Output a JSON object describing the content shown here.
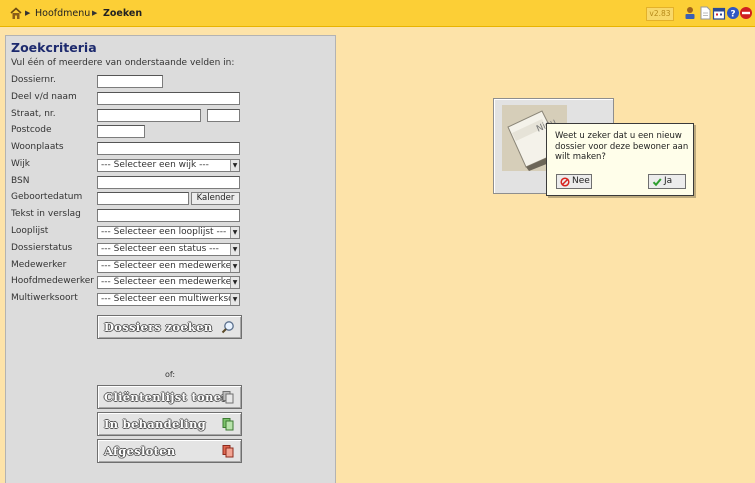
{
  "topbar": {
    "breadcrumb": [
      "Hoofdmenu",
      "Zoeken"
    ],
    "version": "v2.83",
    "icons": [
      "home-icon",
      "user-icon",
      "document-icon",
      "calendar-icon",
      "help-icon",
      "logout-icon"
    ]
  },
  "panel": {
    "title": "Zoekcriteria",
    "intro": "Vul één of meerdere van onderstaande velden in:",
    "labels": {
      "dossiernr": "Dossiernr.",
      "naam": "Deel v/d naam",
      "straat": "Straat, nr.",
      "postcode": "Postcode",
      "woonplaats": "Woonplaats",
      "wijk": "Wijk",
      "bsn": "BSN",
      "geboortedatum": "Geboortedatum",
      "tekst": "Tekst in verslag",
      "looplijst": "Looplijst",
      "dossierstatus": "Dossierstatus",
      "medewerker": "Medewerker",
      "hoofdmedewerker": "Hoofdmedewerker",
      "multiwerksoort": "Multiwerksoort"
    },
    "selects": {
      "wijk": "--- Selecteer een wijk ---",
      "looplijst": "--- Selecteer een looplijst ---",
      "dossierstatus": "--- Selecteer een status ---",
      "medewerker": "--- Selecteer een medewerker ---",
      "hoofdmedewerker": "--- Selecteer een medewerker ---",
      "multiwerksoort": "--- Selecteer een multiwerksoort ---"
    },
    "kalender": "Kalender",
    "search_button": "Dossiers zoeken",
    "of": "of:",
    "client_list_button": "Cliëntenlijst tonen",
    "in_progress_button": "In behandeling",
    "closed_button": "Afgesloten"
  },
  "dialog": {
    "tile_label": "Nieu",
    "message": "Weet u zeker dat u een nieuw dossier voor deze bewoner aan wilt maken?",
    "no": "Nee",
    "yes": "Ja"
  },
  "colors": {
    "background": "#fde3a9",
    "topbar": "#fccf36",
    "panel": "#dcdcdc",
    "title": "#1d2a6e",
    "no_icon": "#d8231f",
    "yes_icon": "#2e9e2e"
  }
}
